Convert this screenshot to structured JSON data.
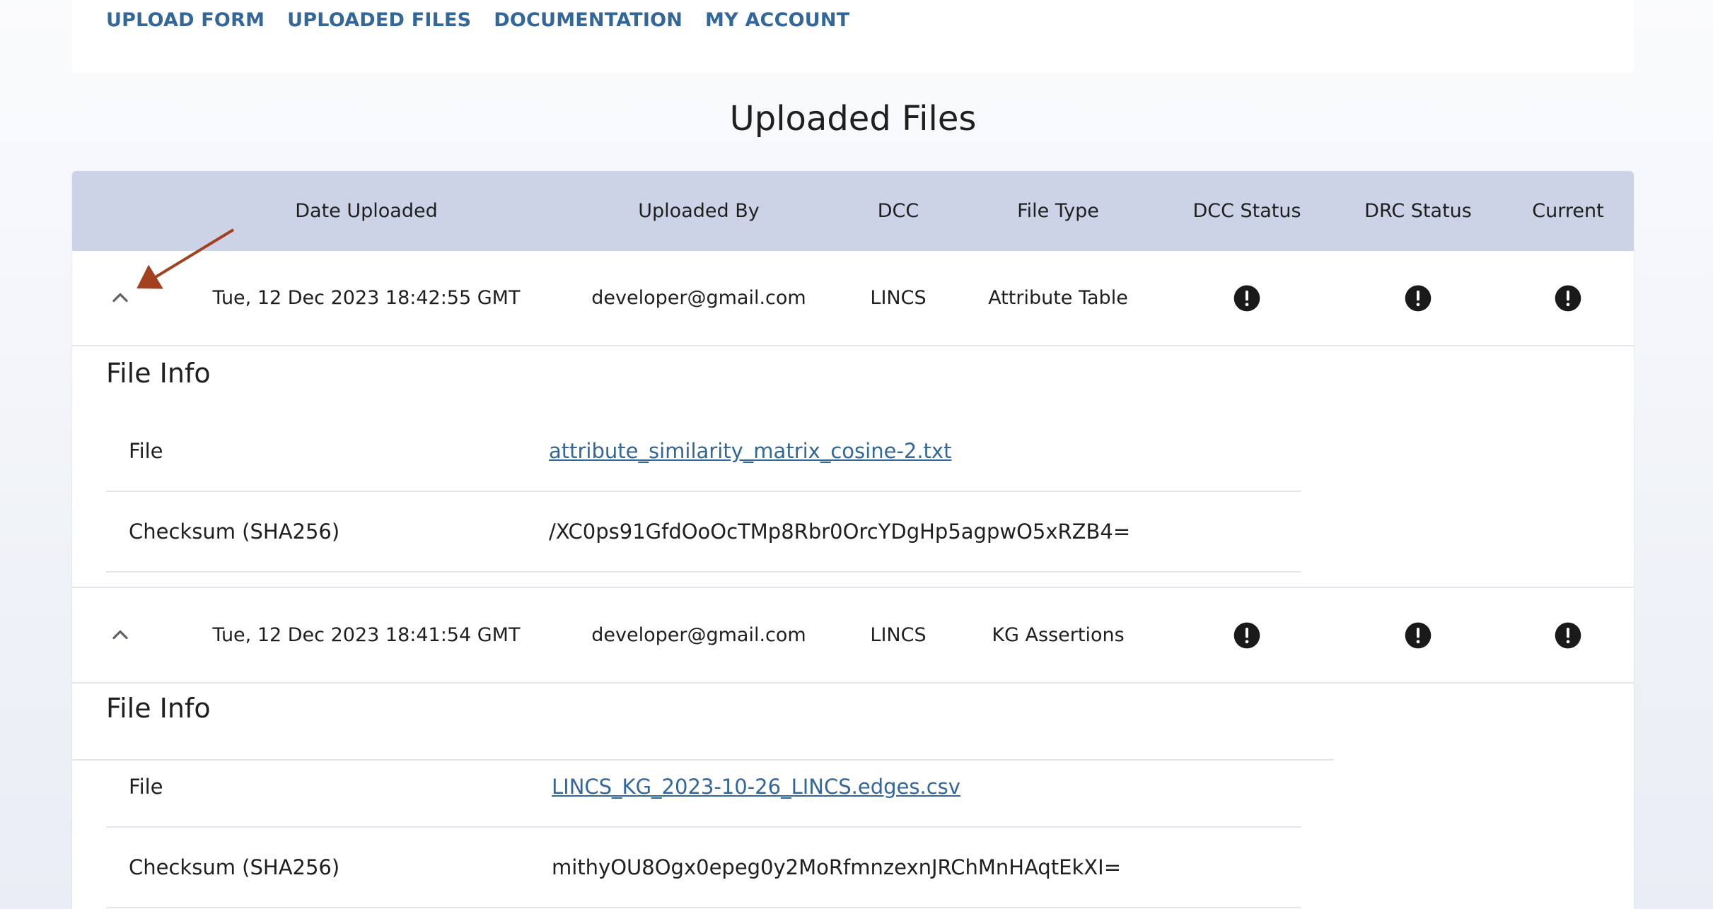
{
  "nav": {
    "items": [
      {
        "label": "UPLOAD FORM"
      },
      {
        "label": "UPLOADED FILES"
      },
      {
        "label": "DOCUMENTATION"
      },
      {
        "label": "MY ACCOUNT"
      }
    ]
  },
  "page": {
    "title": "Uploaded Files"
  },
  "table": {
    "columns": [
      "Date Uploaded",
      "Uploaded By",
      "DCC",
      "File Type",
      "DCC Status",
      "DRC Status",
      "Current"
    ],
    "rows": [
      {
        "date": "Tue, 12 Dec 2023 18:42:55 GMT",
        "uploaded_by": "developer@gmail.com",
        "dcc": "LINCS",
        "file_type": "Attribute Table",
        "dcc_status_icon": "exclamation-circle-icon",
        "drc_status_icon": "exclamation-circle-icon",
        "current_icon": "exclamation-circle-icon",
        "expanded": true,
        "info": {
          "title": "File Info",
          "file_label": "File",
          "file_name": "attribute_similarity_matrix_cosine-2.txt",
          "checksum_label": "Checksum (SHA256)",
          "checksum": "/XC0ps91GfdOoOcTMp8Rbr0OrcYDgHp5agpwO5xRZB4="
        }
      },
      {
        "date": "Tue, 12 Dec 2023 18:41:54 GMT",
        "uploaded_by": "developer@gmail.com",
        "dcc": "LINCS",
        "file_type": "KG Assertions",
        "dcc_status_icon": "exclamation-circle-icon",
        "drc_status_icon": "exclamation-circle-icon",
        "current_icon": "exclamation-circle-icon",
        "expanded": true,
        "info": {
          "title": "File Info",
          "file_label": "File",
          "file_name": "LINCS_KG_2023-10-26_LINCS.edges.csv",
          "checksum_label": "Checksum (SHA256)",
          "checksum": "mithyOU8Ogx0epeg0y2MoRfmnzexnJRChMnHAqtEkXI="
        }
      }
    ]
  },
  "colors": {
    "link": "#336699",
    "header_bg": "#ccd3e6",
    "annotation_arrow": "#a3401e",
    "status_icon": "#1a1a1a"
  }
}
